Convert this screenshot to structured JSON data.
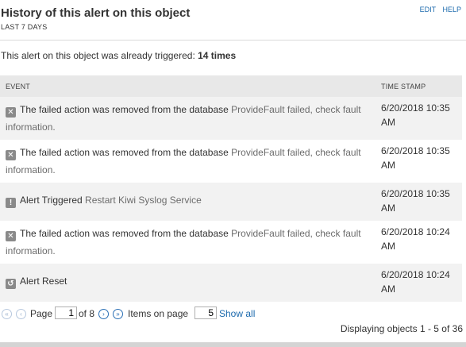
{
  "header": {
    "title": "History of this alert on this object",
    "subtitle": "LAST 7 DAYS",
    "edit_label": "EDIT",
    "help_label": "HELP"
  },
  "summary": {
    "prefix": "This alert on this object was already triggered: ",
    "count_text": "14 times"
  },
  "table": {
    "columns": [
      "EVENT",
      "TIME STAMP"
    ],
    "rows": [
      {
        "icon": "error-x-icon",
        "text": "The failed action was removed from the database",
        "link": "ProvideFault failed, check fault information.",
        "time": "6/20/2018 10:35 AM"
      },
      {
        "icon": "error-x-icon",
        "text": "The failed action was removed from the database",
        "link": "ProvideFault failed, check fault information.",
        "time": "6/20/2018 10:35 AM"
      },
      {
        "icon": "alert-exclamation-icon",
        "text": "Alert Triggered",
        "link": "Restart Kiwi Syslog Service",
        "time": "6/20/2018 10:35 AM"
      },
      {
        "icon": "error-x-icon",
        "text": "The failed action was removed from the database",
        "link": "ProvideFault failed, check fault information.",
        "time": "6/20/2018 10:24 AM"
      },
      {
        "icon": "reset-icon",
        "text": "Alert Reset",
        "link": "",
        "time": "6/20/2018 10:24 AM"
      }
    ]
  },
  "pager": {
    "page_label": "Page",
    "current_page": "1",
    "of_text": "of 8",
    "items_label": "Items on page",
    "items_value": "5",
    "show_all": "Show all",
    "displaying": "Displaying objects 1 - 5 of 36"
  },
  "colors": {
    "link": "#1c6aad",
    "header_bg": "#e8e8e8",
    "alt_row_bg": "#f2f2f2",
    "icon_bg": "#8a8a8a"
  }
}
